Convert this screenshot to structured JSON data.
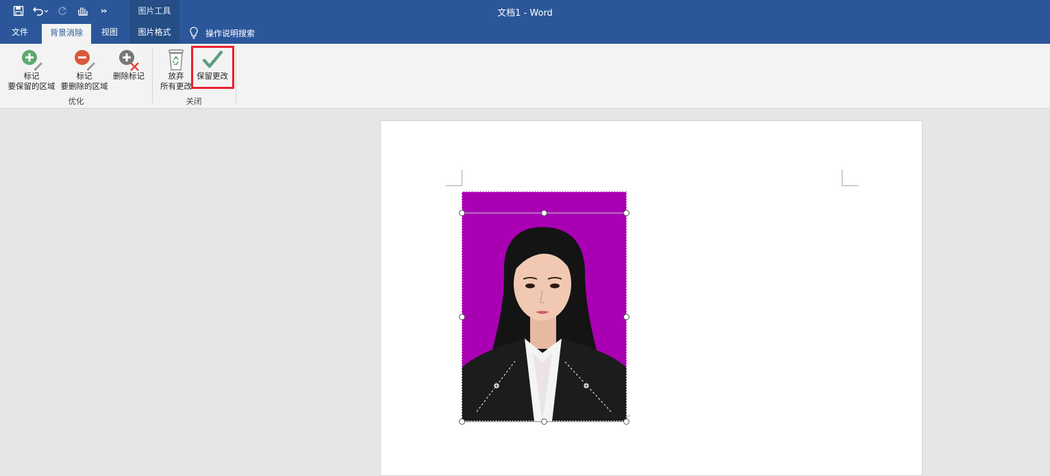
{
  "window": {
    "title": "文档1  -  Word",
    "context_tools_label": "图片工具"
  },
  "colors": {
    "title_bar": "#2b579a",
    "ribbon_bg": "#f3f3f3",
    "workspace_bg": "#e6e6e6",
    "highlight_box": "#e8202f",
    "photo_background": "#aa00b4"
  },
  "quick_access": [
    {
      "name": "save-icon"
    },
    {
      "name": "undo-icon"
    },
    {
      "name": "redo-icon"
    },
    {
      "name": "touch-mode-icon"
    },
    {
      "name": "more-commands-icon"
    }
  ],
  "tabs": {
    "file": "文件",
    "background_removal": "背景消除",
    "view": "视图",
    "picture_format": "图片格式",
    "tell_me": "操作说明搜索"
  },
  "ribbon": {
    "mark_keep": {
      "line1": "标记",
      "line2": "要保留的区域"
    },
    "mark_remove": {
      "line1": "标记",
      "line2": "要删除的区域"
    },
    "delete_mark": {
      "line1": "删除标记"
    },
    "discard": {
      "line1": "放弃",
      "line2": "所有更改"
    },
    "keep_changes": {
      "line1": "保留更改"
    },
    "group_refine": "优化",
    "group_close": "关闭"
  }
}
